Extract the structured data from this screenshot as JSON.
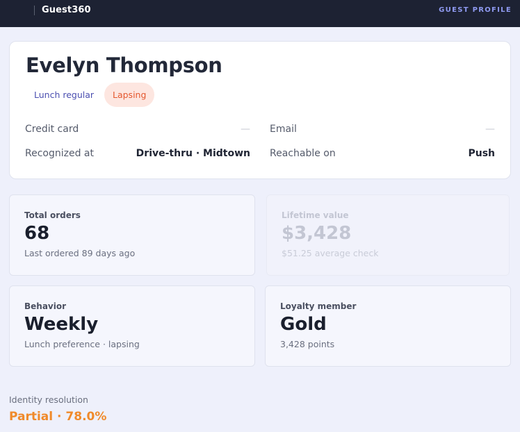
{
  "app": {
    "brand": "Guest360",
    "page_label": "GUEST PROFILE"
  },
  "profile": {
    "name": "Evelyn Thompson",
    "tags": [
      {
        "label": "Lunch regular"
      },
      {
        "label": "Lapsing"
      }
    ],
    "fields": {
      "credit_card": {
        "label": "Credit card",
        "value": "—"
      },
      "email": {
        "label": "Email",
        "value": "—"
      },
      "recognized_at": {
        "label": "Recognized at",
        "value": "Drive-thru · Midtown"
      },
      "reachable_on": {
        "label": "Reachable on",
        "value": "Push"
      }
    }
  },
  "stats": {
    "total_orders": {
      "label": "Total orders",
      "value": "68",
      "sub": "Last ordered 89 days ago"
    },
    "lifetime_value": {
      "label": "Lifetime value",
      "value": "$3,428",
      "sub": "$51.25 average check"
    },
    "behavior": {
      "label": "Behavior",
      "value": "Weekly",
      "sub": "Lunch preference · lapsing"
    },
    "loyalty": {
      "label": "Loyalty member",
      "value": "Gold",
      "sub": "3,428 points"
    }
  },
  "identity": {
    "label": "Identity resolution",
    "value": "Partial · 78.0%"
  },
  "colors": {
    "topbar": "#1d2233",
    "accent": "#8f9af0",
    "lapsing": "#e4572e",
    "identity": "#f08a2a"
  }
}
